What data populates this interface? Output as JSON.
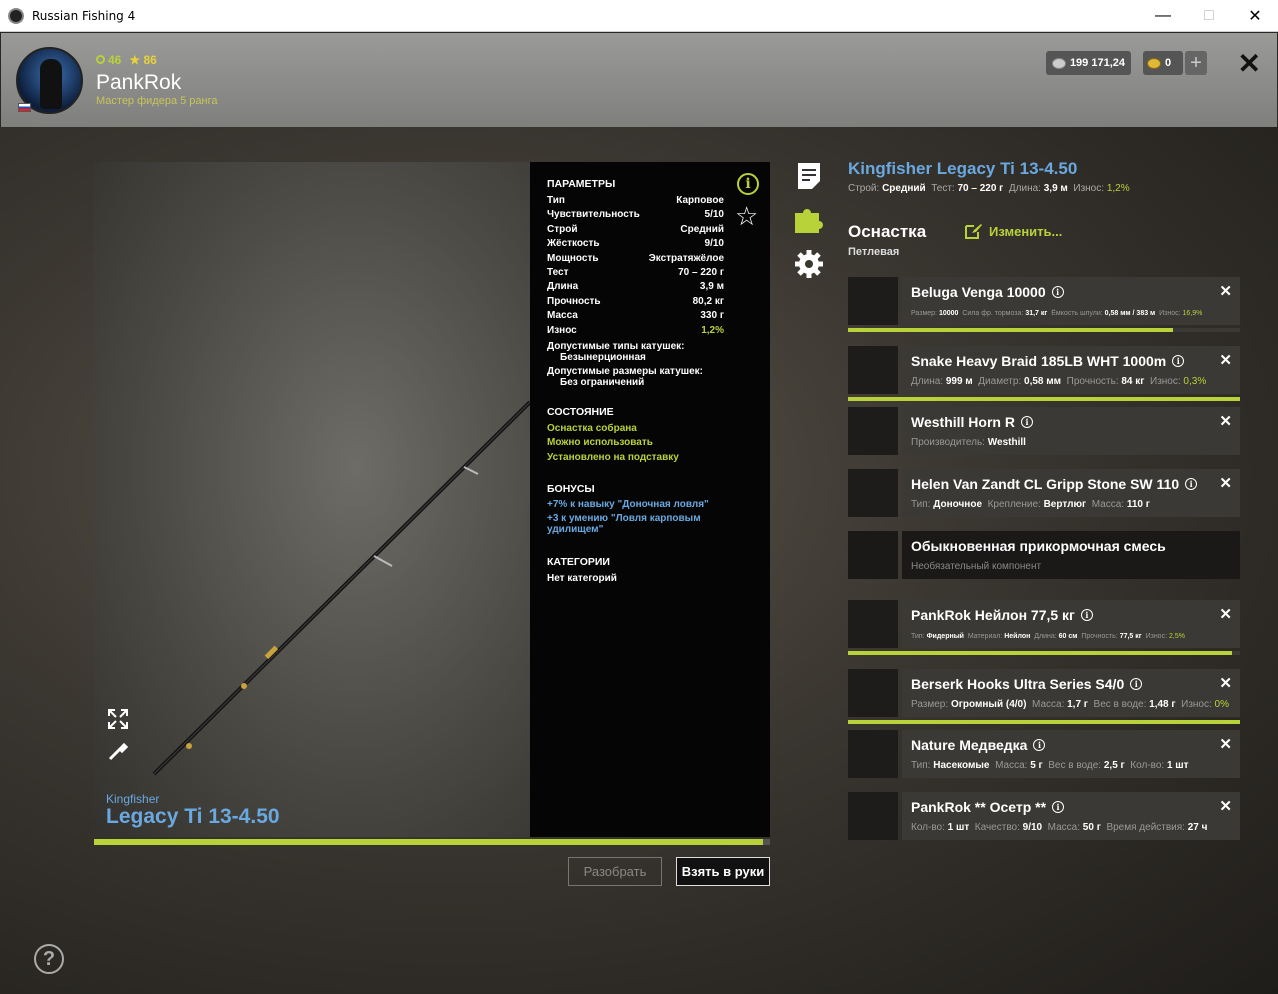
{
  "window": {
    "title": "Russian Fishing 4"
  },
  "header": {
    "level": "46",
    "stars": "86",
    "player_name": "PankRok",
    "rank": "Мастер фидера 5 ранга",
    "silver": "199 171,24",
    "gold": "0"
  },
  "rod": {
    "brand": "Kingfisher",
    "model": "Legacy Ti 13-4.50",
    "durability_fraction": 0.99
  },
  "params": {
    "section_title": "ПАРАМЕТРЫ",
    "rows": [
      {
        "label": "Тип",
        "value": "Карповое"
      },
      {
        "label": "Чувствительность",
        "value": "5/10"
      },
      {
        "label": "Строй",
        "value": "Средний"
      },
      {
        "label": "Жёсткость",
        "value": "9/10"
      },
      {
        "label": "Мощность",
        "value": "Экстратяжёлое"
      },
      {
        "label": "Тест",
        "value": "70 – 220 г"
      },
      {
        "label": "Длина",
        "value": "3,9 м"
      },
      {
        "label": "Прочность",
        "value": "80,2 кг"
      },
      {
        "label": "Масса",
        "value": "330 г"
      },
      {
        "label": "Износ",
        "value": "1,2%"
      }
    ],
    "reel_types_label": "Допустимые типы катушек:",
    "reel_types_value": "Безынерционная",
    "reel_sizes_label": "Допустимые размеры катушек:",
    "reel_sizes_value": "Без ограничений",
    "state_title": "СОСТОЯНИЕ",
    "state_items": [
      "Оснастка собрана",
      "Можно использовать",
      "Установлено на подставку"
    ],
    "bonus_title": "БОНУСЫ",
    "bonus_1": "+7% к навыку \"Доночная ловля\"",
    "bonus_2a": "+3 к умению \"Ловля карповым",
    "bonus_2b": "удилищем\"",
    "categories_title": "КАТЕГОРИИ",
    "categories_value": "Нет категорий"
  },
  "buttons": {
    "disassemble": "Разобрать",
    "take": "Взять в руки",
    "help": "?"
  },
  "item": {
    "title": "Kingfisher Legacy Ti 13-4.50",
    "sub_build_label": "Строй:",
    "sub_build": "Средний",
    "sub_test_label": "Тест:",
    "sub_test": "70 – 220 г",
    "sub_length_label": "Длина:",
    "sub_length": "3,9 м",
    "sub_wear_label": "Износ:",
    "sub_wear": "1,2%"
  },
  "rig": {
    "title": "Оснастка",
    "type": "Петлевая",
    "edit_label": "Изменить..."
  },
  "slots": [
    {
      "name": "Beluga Venga 10000",
      "meta": [
        [
          "Размер:",
          "10000"
        ],
        [
          "Сила фр. тормоза:",
          "31,7 кг"
        ],
        [
          "Ёмкость шпули:",
          "0,58 мм / 383 м"
        ],
        [
          "Износ:",
          "16,9%"
        ]
      ],
      "tiny": true,
      "bar": 0.83
    },
    {
      "name": "Snake Heavy Braid 185LB WHT 1000m",
      "meta": [
        [
          "Длина:",
          "999 м"
        ],
        [
          "Диаметр:",
          "0,58 мм"
        ],
        [
          "Прочность:",
          "84 кг"
        ],
        [
          "Износ:",
          "0,3%"
        ]
      ],
      "bar": 1.0
    },
    {
      "name": "Westhill Horn R",
      "meta": [
        [
          "Производитель:",
          "Westhill"
        ]
      ]
    },
    {
      "name": "Helen Van Zandt CL Gripp Stone SW 110",
      "meta": [
        [
          "Тип:",
          "Доночное"
        ],
        [
          "Крепление:",
          "Вертлюг"
        ],
        [
          "Масса:",
          "110 г"
        ]
      ]
    },
    {
      "name": "Обыкновенная прикормочная смесь",
      "meta_plain": "Необязательный компонент",
      "empty": true
    },
    {
      "name": "PankRok Нейлон 77,5 кг",
      "meta": [
        [
          "Тип:",
          "Фидерный"
        ],
        [
          "Материал:",
          "Нейлон"
        ],
        [
          "Длина:",
          "60 см"
        ],
        [
          "Прочность:",
          "77,5 кг"
        ],
        [
          "Износ:",
          "2,5%"
        ]
      ],
      "tiny": true,
      "bar": 0.98
    },
    {
      "name": "Berserk Hooks Ultra Series S4/0",
      "meta": [
        [
          "Размер:",
          "Огромный (4/0)"
        ],
        [
          "Масса:",
          "1,7 г"
        ],
        [
          "Вес в воде:",
          "1,48 г"
        ],
        [
          "Износ:",
          "0%"
        ]
      ],
      "bar": 1.0
    },
    {
      "name": "Nature Медведка",
      "meta": [
        [
          "Тип:",
          "Насекомые"
        ],
        [
          "Масса:",
          "5 г"
        ],
        [
          "Вес в воде:",
          "2,5 г"
        ],
        [
          "Кол-во:",
          "1 шт"
        ]
      ]
    },
    {
      "name": "PankRok ** Осетр **",
      "meta": [
        [
          "Кол-во:",
          "1 шт"
        ],
        [
          "Качество:",
          "9/10"
        ],
        [
          "Масса:",
          "50 г"
        ],
        [
          "Время действия:",
          "27 ч"
        ]
      ]
    }
  ],
  "colors": {
    "accent": "#b8d23a",
    "link_blue": "#6aa8e0",
    "panel": "#3b3935"
  }
}
